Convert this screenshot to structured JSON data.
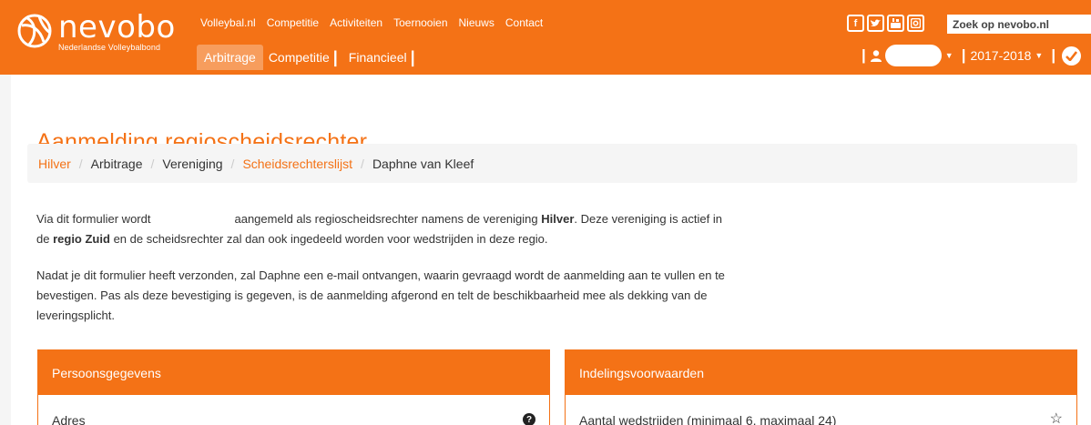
{
  "header": {
    "logo": {
      "word": "nevobo",
      "subtitle": "Nederlandse Volleybalbond"
    },
    "main_nav": [
      "Volleybal.nl",
      "Competitie",
      "Activiteiten",
      "Toernooien",
      "Nieuws",
      "Contact"
    ],
    "sub_nav": {
      "active": "Arbitrage",
      "items": [
        "Competitie",
        "Financieel"
      ]
    },
    "social_icons": [
      "facebook-icon",
      "twitter-icon",
      "youtube-icon",
      "instagram-icon"
    ],
    "search": {
      "placeholder": "Zoek op nevobo.nl",
      "value": ""
    },
    "season": "2017-2018"
  },
  "page": {
    "title": "Aanmelding regioscheidsrechter",
    "breadcrumb": [
      {
        "label": "Hilver",
        "link": true
      },
      {
        "label": "Arbitrage",
        "link": false
      },
      {
        "label": "Vereniging",
        "link": false
      },
      {
        "label": "Scheidsrechterslijst",
        "link": true
      },
      {
        "label": "Daphne van Kleef",
        "link": false
      }
    ],
    "intro": {
      "p1_a": "Via dit formulier wordt",
      "p1_b": "aangemeld als regioscheidsrechter namens de vereniging",
      "club": "Hilver",
      "p1_c": ". Deze vereniging is actief in de",
      "region": "regio Zuid",
      "p1_d": "en de scheidsrechter zal dan ook ingedeeld worden voor wedstrijden in deze regio.",
      "p2": "Nadat je dit formulier heeft verzonden, zal Daphne een e-mail ontvangen, waarin gevraagd wordt de aanmelding aan te vullen en te bevestigen. Pas als deze bevestiging is gegeven, is de aanmelding afgerond en telt de beschikbaarheid mee als dekking van de leveringsplicht."
    },
    "panels": [
      {
        "title": "Persoonsgegevens",
        "first_field": "Adres"
      },
      {
        "title": "Indelingsvoorwaarden",
        "first_field": "Aantal wedstrijden (minimaal 6, maximaal 24)"
      }
    ]
  },
  "colors": {
    "brand": "#f47216",
    "active_tab": "#f79d5d",
    "breadcrumb_bg": "#f5f5f5"
  }
}
